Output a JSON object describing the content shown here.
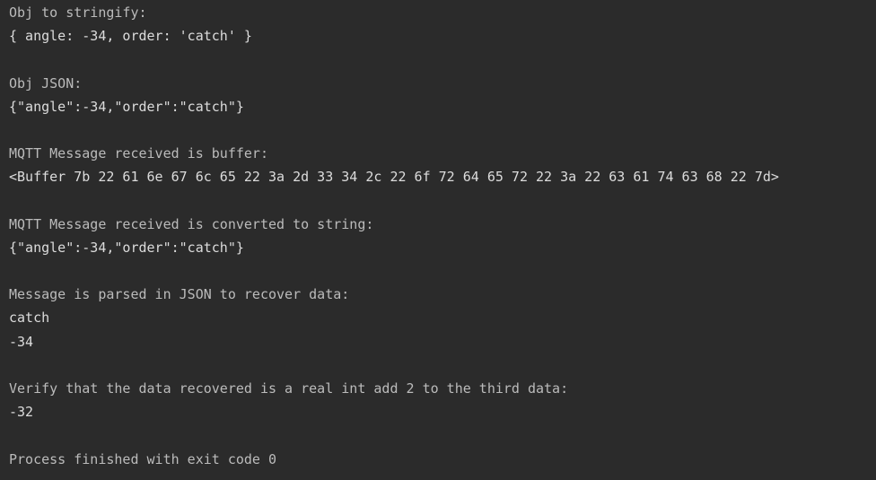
{
  "console": {
    "lines": [
      {
        "text": "Obj to stringify:",
        "kind": "label"
      },
      {
        "text": "{ angle: -34, order: 'catch' }",
        "kind": "stdout"
      },
      {
        "text": "",
        "kind": "blank"
      },
      {
        "text": "Obj JSON:",
        "kind": "label"
      },
      {
        "text": "{\"angle\":-34,\"order\":\"catch\"}",
        "kind": "stdout"
      },
      {
        "text": "",
        "kind": "blank"
      },
      {
        "text": "MQTT Message received is buffer:",
        "kind": "label"
      },
      {
        "text": "<Buffer 7b 22 61 6e 67 6c 65 22 3a 2d 33 34 2c 22 6f 72 64 65 72 22 3a 22 63 61 74 63 68 22 7d>",
        "kind": "stdout"
      },
      {
        "text": "",
        "kind": "blank"
      },
      {
        "text": "MQTT Message received is converted to string:",
        "kind": "label"
      },
      {
        "text": "{\"angle\":-34,\"order\":\"catch\"}",
        "kind": "stdout"
      },
      {
        "text": "",
        "kind": "blank"
      },
      {
        "text": "Message is parsed in JSON to recover data:",
        "kind": "label"
      },
      {
        "text": "catch",
        "kind": "stdout"
      },
      {
        "text": "-34",
        "kind": "stdout"
      },
      {
        "text": "",
        "kind": "blank"
      },
      {
        "text": "Verify that the data recovered is a real int add 2 to the third data:",
        "kind": "label"
      },
      {
        "text": "-32",
        "kind": "stdout"
      },
      {
        "text": "",
        "kind": "blank"
      },
      {
        "text": "Process finished with exit code 0",
        "kind": "label"
      }
    ]
  },
  "colors": {
    "background": "#2b2b2b",
    "text": "#bbbbbb"
  }
}
